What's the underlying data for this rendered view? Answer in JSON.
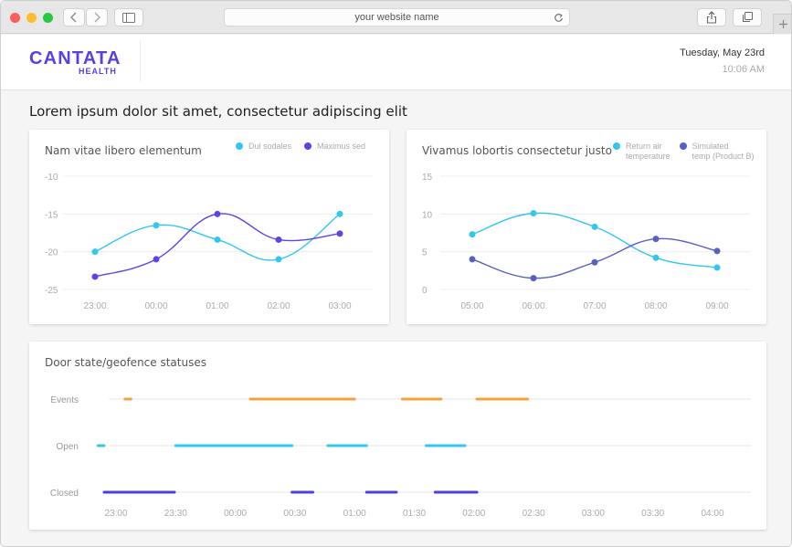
{
  "browser": {
    "url_text": "your website name"
  },
  "header": {
    "logo_main": "CANTATA",
    "logo_sub": "HEALTH",
    "date": "Tuesday, May 23rd",
    "time": "10:06 AM"
  },
  "page": {
    "title": "Lorem ipsum dolor sit amet, consectetur adipiscing elit"
  },
  "colors": {
    "cyan": "#33c6ee",
    "purple": "#5b45e6",
    "slate": "#5960c2",
    "orange": "#f5a23a",
    "blue_bar": "#4b3fe0",
    "brand": "#5b3fe0"
  },
  "chart_data": [
    {
      "type": "line",
      "title": "Nam vitae libero elementum",
      "categories": [
        "23:00",
        "00:00",
        "01:00",
        "02:00",
        "03:00"
      ],
      "ylim": [
        -25,
        -10
      ],
      "yticks": [
        -10,
        -15,
        -20,
        -25
      ],
      "ytick_labels": [
        "-10",
        "-15",
        "-20",
        "-25"
      ],
      "legend": "top-right",
      "series": [
        {
          "name": "Dui sodales",
          "color": "#33c6ee",
          "values": [
            -20,
            -16.5,
            -18.4,
            -21,
            -15
          ]
        },
        {
          "name": "Maximus sed",
          "color": "#5b45e6",
          "values": [
            -23.3,
            -21,
            -15,
            -18.4,
            -17.6
          ]
        }
      ]
    },
    {
      "type": "line",
      "title": "Vivamus lobortis consectetur justo",
      "categories": [
        "05:00",
        "06:00",
        "07:00",
        "08:00",
        "09:00"
      ],
      "ylim": [
        0,
        15
      ],
      "yticks": [
        15,
        10,
        5,
        0
      ],
      "ytick_labels": [
        "15",
        "10",
        "5",
        "0"
      ],
      "legend": "top-right",
      "series": [
        {
          "name": "Return air temperature",
          "label_lines": [
            "Return air",
            "temperature"
          ],
          "color": "#33c6ee",
          "values": [
            7.3,
            10.1,
            8.3,
            4.2,
            2.9
          ]
        },
        {
          "name": "Simulated temp (Product B)",
          "label_lines": [
            "Simulated",
            "temp (Product B)"
          ],
          "color": "#5960c2",
          "values": [
            4,
            1.5,
            3.6,
            6.7,
            5.1
          ]
        }
      ]
    },
    {
      "type": "timeline",
      "title": "Door state/geofence statuses",
      "xticks": [
        "23:00",
        "23:30",
        "00:00",
        "00:30",
        "01:00",
        "01:30",
        "02:00",
        "02:30",
        "03:00",
        "03:30",
        "04:00"
      ],
      "rows": [
        {
          "label": "Events",
          "color": "#f5a23a",
          "segments": [
            [
              0.15,
              0.25
            ],
            [
              2.25,
              4.0
            ],
            [
              4.8,
              5.45
            ],
            [
              6.05,
              6.9
            ]
          ]
        },
        {
          "label": "Open",
          "color": "#33c6ee",
          "segments": [
            [
              -0.3,
              -0.2
            ],
            [
              1.0,
              2.95
            ],
            [
              3.55,
              4.2
            ],
            [
              5.2,
              5.85
            ]
          ]
        },
        {
          "label": "Closed",
          "color": "#4b3fe0",
          "segments": [
            [
              -0.2,
              0.98
            ],
            [
              2.95,
              3.3
            ],
            [
              4.2,
              4.7
            ],
            [
              5.35,
              6.05
            ]
          ]
        }
      ]
    }
  ]
}
